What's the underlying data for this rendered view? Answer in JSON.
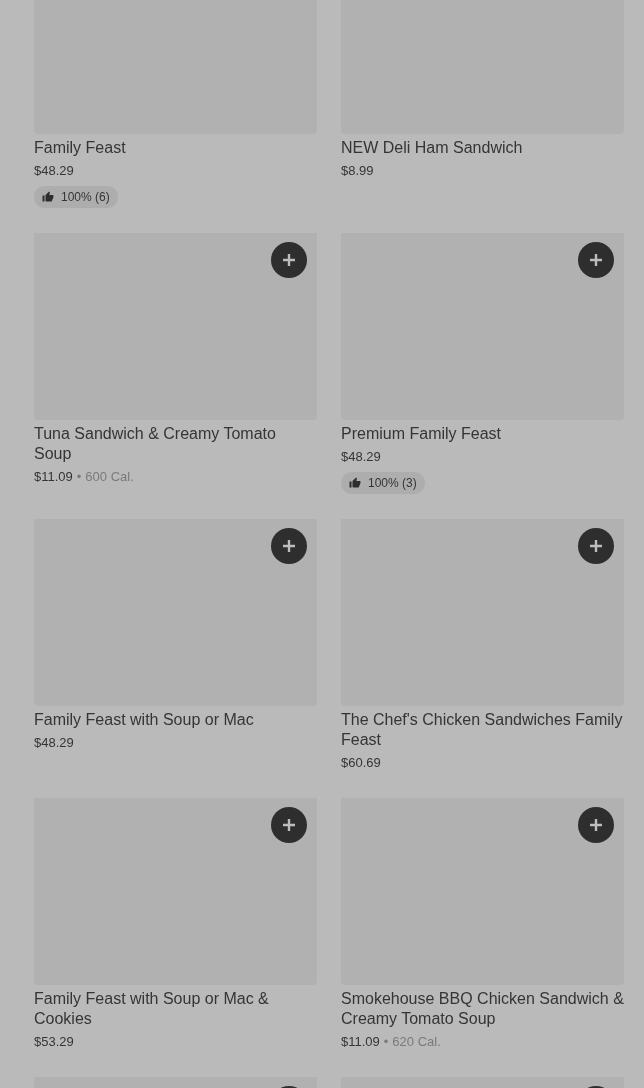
{
  "items": [
    {
      "kind": "cut-top",
      "title": "Family Feast",
      "price": "$48.29",
      "rating": "100% (6)"
    },
    {
      "kind": "cut-top",
      "title": "NEW Deli Ham Sandwich",
      "price": "$8.99"
    },
    {
      "kind": "full",
      "title": "Tuna Sandwich & Creamy Tomato Soup",
      "price": "$11.09",
      "separator": "•",
      "calories": "600 Cal."
    },
    {
      "kind": "full",
      "title": "Premium Family Feast",
      "price": "$48.29",
      "rating": "100% (3)"
    },
    {
      "kind": "full",
      "title": "Family Feast with Soup or Mac",
      "price": "$48.29"
    },
    {
      "kind": "full",
      "title": "The Chef's Chicken Sandwiches Family Feast",
      "price": "$60.69"
    },
    {
      "kind": "full",
      "title": "Family Feast with Soup or Mac & Cookies",
      "price": "$53.29"
    },
    {
      "kind": "full",
      "title": "Smokehouse BBQ Chicken Sandwich & Creamy Tomato Soup",
      "price": "$11.09",
      "separator": "•",
      "calories": "620 Cal."
    },
    {
      "kind": "cut-bottom"
    },
    {
      "kind": "cut-bottom"
    }
  ]
}
